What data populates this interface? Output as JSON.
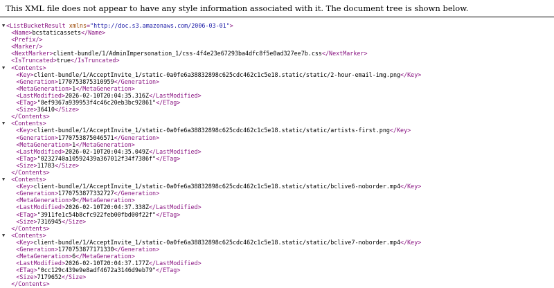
{
  "header": {
    "notice": "This XML file does not appear to have any style information associated with it. The document tree is shown below."
  },
  "toggle_glyph": "▼",
  "root": {
    "tag": "ListBucketResult",
    "xmlns_attr": "xmlns",
    "xmlns_value": "\"http://doc.s3.amazonaws.com/2006-03-01\""
  },
  "fields": {
    "name": "bcstaticassets",
    "prefix": "",
    "marker": "",
    "next_marker": "client-bundle/1/AdminImpersonation_1/css-4f4e23e67293ba4dfc8f5e0ad327ee7b.css",
    "is_truncated": "true"
  },
  "contents": [
    {
      "key": "client-bundle/1/AcceptInvite_1/static-0a0fe6a38832898c625cdc462c1c5e18.static/static/2-hour-email-img.png",
      "generation": "1770753875310959",
      "meta_generation": "1",
      "last_modified": "2026-02-10T20:04:35.316Z",
      "etag": "\"8ef9367a939953f4c46c20eb3bc92861\"",
      "size": "36410"
    },
    {
      "key": "client-bundle/1/AcceptInvite_1/static-0a0fe6a38832898c625cdc462c1c5e18.static/static/artists-first.png",
      "generation": "1770753875046571",
      "meta_generation": "1",
      "last_modified": "2026-02-10T20:04:35.049Z",
      "etag": "\"0232740a10592439a367012f34f7386f\"",
      "size": "11783"
    },
    {
      "key": "client-bundle/1/AcceptInvite_1/static-0a0fe6a38832898c625cdc462c1c5e18.static/static/bclive6-noborder.mp4",
      "generation": "1770753877332727",
      "meta_generation": "9",
      "last_modified": "2026-02-10T20:04:37.338Z",
      "etag": "\"3911fe1c54b8cfc922feb00fbd00f22f\"",
      "size": "7316945"
    },
    {
      "key": "client-bundle/1/AcceptInvite_1/static-0a0fe6a38832898c625cdc462c1c5e18.static/static/bclive7-noborder.mp4",
      "generation": "1770753877171330",
      "meta_generation": "6",
      "last_modified": "2026-02-10T20:04:37.177Z",
      "etag": "\"0cc129c439e9e8adf4672a3146d9eb79\"",
      "size": "7179652"
    }
  ]
}
